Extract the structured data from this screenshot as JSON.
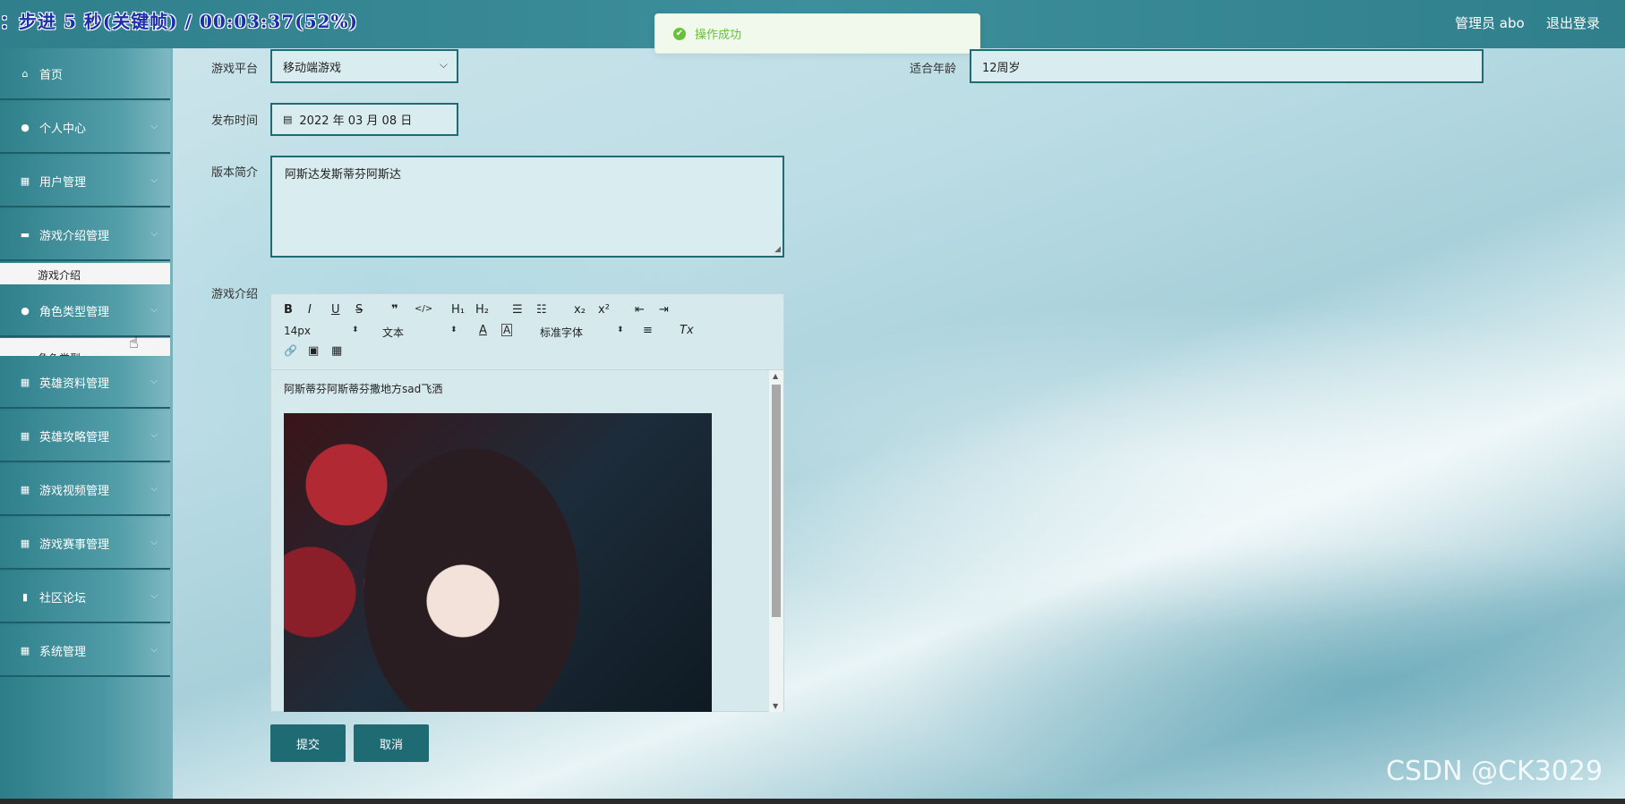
{
  "overlay": {
    "title": "：步进 5 秒(关键帧) / 00:03:37(52%)"
  },
  "header": {
    "user": "管理员 abo",
    "logout": "退出登录"
  },
  "toast": {
    "message": "操作成功"
  },
  "sidebar": {
    "items": [
      {
        "label": "首页",
        "icon": "home-icon"
      },
      {
        "label": "个人中心",
        "icon": "user-icon"
      },
      {
        "label": "用户管理",
        "icon": "grid-icon"
      },
      {
        "label": "游戏介绍管理",
        "icon": "chat-icon"
      },
      {
        "label": "角色类型管理",
        "icon": "user-icon"
      },
      {
        "label": "英雄资料管理",
        "icon": "grid-icon"
      },
      {
        "label": "英雄攻略管理",
        "icon": "grid-icon"
      },
      {
        "label": "游戏视频管理",
        "icon": "grid-icon"
      },
      {
        "label": "游戏赛事管理",
        "icon": "grid-icon"
      },
      {
        "label": "社区论坛",
        "icon": "book-icon"
      },
      {
        "label": "系统管理",
        "icon": "grid-icon"
      }
    ],
    "submenus": [
      {
        "label": "游戏介绍"
      },
      {
        "label": "角色类型"
      }
    ]
  },
  "form": {
    "platform": {
      "label": "游戏平台",
      "value": "移动端游戏"
    },
    "age": {
      "label": "适合年龄",
      "value": "12周岁"
    },
    "publish_time": {
      "label": "发布时间",
      "value": "2022 年 03 月 08 日"
    },
    "version_intro": {
      "label": "版本简介",
      "value": "阿斯达发斯蒂芬阿斯达"
    },
    "game_intro": {
      "label": "游戏介绍",
      "content": "阿斯蒂芬阿斯蒂芬撒地方sad飞洒"
    }
  },
  "editor_toolbar": {
    "bold": "B",
    "italic": "I",
    "underline": "U",
    "strike": "S",
    "quote": "❞",
    "code": "</>",
    "h1": "H₁",
    "h2": "H₂",
    "ordered_list": "☰",
    "bullet_list": "☷",
    "subscript": "x₂",
    "superscript": "x²",
    "outdent": "⇤",
    "indent": "⇥",
    "font_size": "14px",
    "text_type": "文本",
    "font_family": "标准字体",
    "font_color": "A",
    "background_color": "A",
    "align": "≡",
    "clear_format": "Tx",
    "link": "🔗",
    "image": "▣",
    "video": "▦"
  },
  "buttons": {
    "submit": "提交",
    "cancel": "取消"
  },
  "watermark": "CSDN @CK3029",
  "colors": {
    "primary": "#1e6b74",
    "success": "#67c23a"
  }
}
